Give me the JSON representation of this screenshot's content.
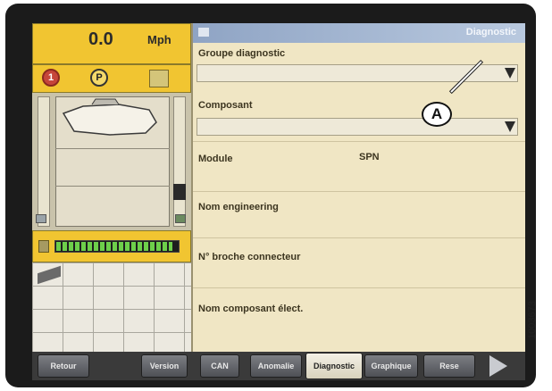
{
  "left_panel": {
    "speed_value": "0.0",
    "speed_unit": "Mph",
    "indicator_1": "1",
    "indicator_p": "P"
  },
  "header": {
    "title": "Diagnostic"
  },
  "fields": {
    "group_label": "Groupe diagnostic",
    "group_value": "",
    "component_label": "Composant",
    "component_value": "",
    "module_label": "Module",
    "spn_label": "SPN",
    "engineering_label": "Nom engineering",
    "pin_label": "N° broche connecteur",
    "electrical_label": "Nom composant élect."
  },
  "bottom_bar": {
    "retour": "Retour",
    "version": "Version",
    "can": "CAN",
    "anomalie": "Anomalie",
    "diagnostic": "Diagnostic",
    "graphique": "Graphique",
    "reset": "Rese"
  },
  "annotation": {
    "callout": "A",
    "figure_id": "1003673"
  },
  "colors": {
    "accent": "#f1c531",
    "panel": "#f0e6c4",
    "titlebar": "#8fa4c4"
  }
}
